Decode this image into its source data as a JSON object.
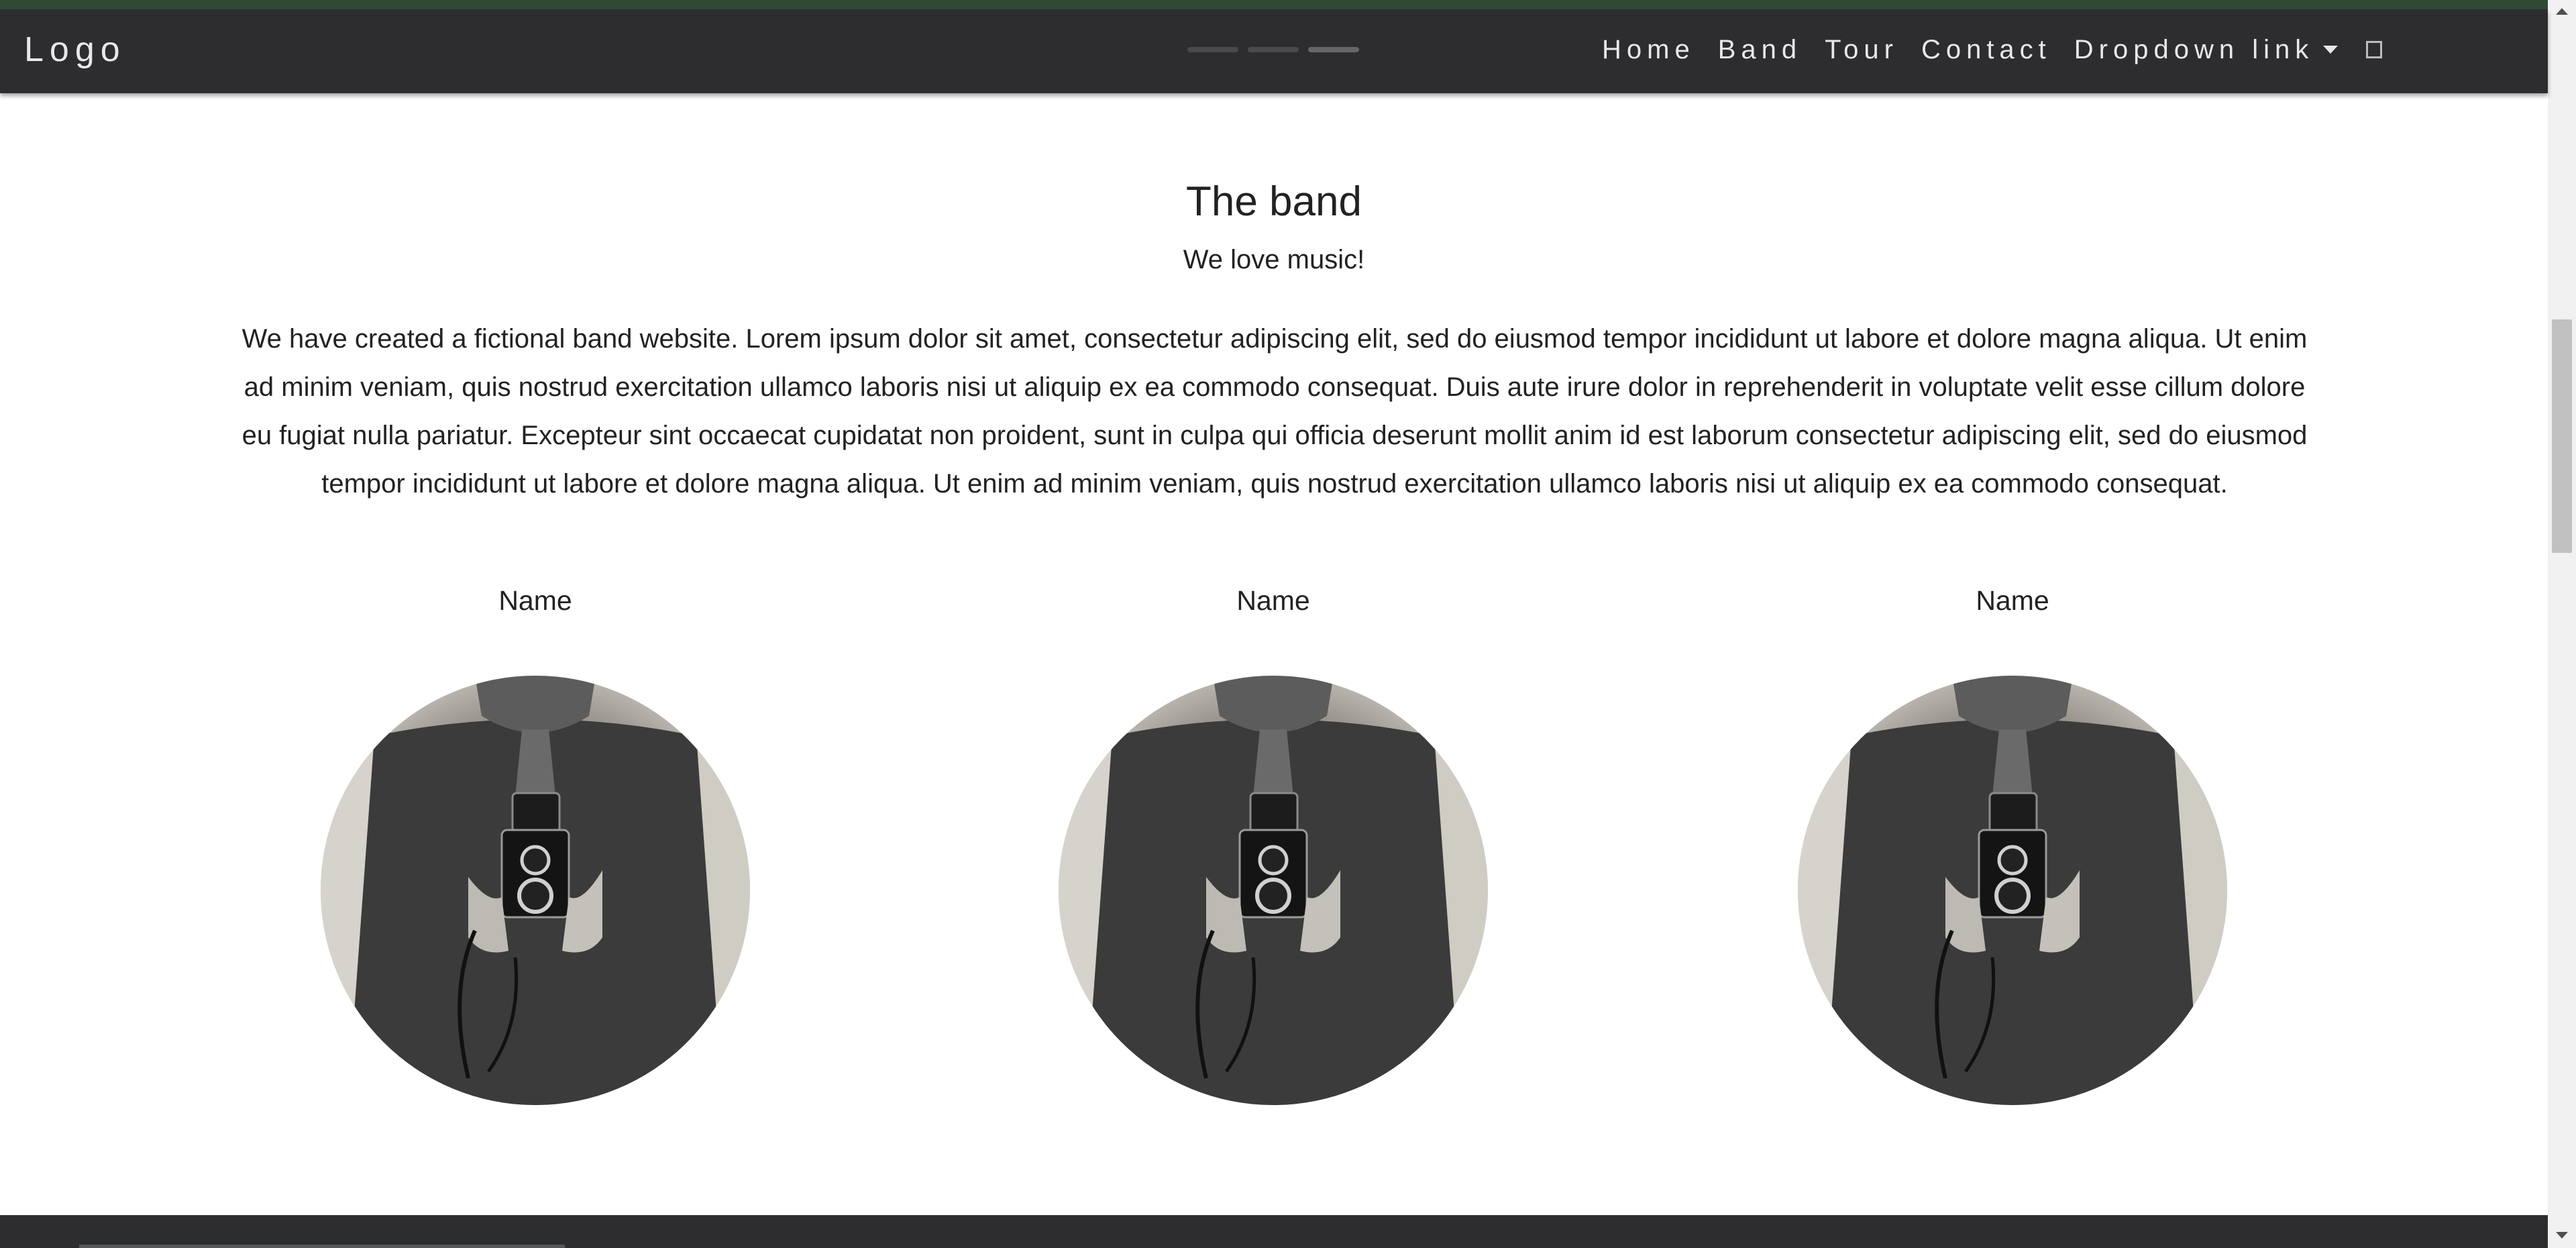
{
  "navbar": {
    "brand": "Logo",
    "items": [
      {
        "label": "Home"
      },
      {
        "label": "Band"
      },
      {
        "label": "Tour"
      },
      {
        "label": "Contact"
      }
    ],
    "dropdown_label": "Dropdown link",
    "search_glyph": "▯"
  },
  "section": {
    "title": "The band",
    "subtitle": "We love music!",
    "body": "We have created a fictional band website. Lorem ipsum dolor sit amet, consectetur adipiscing elit, sed do eiusmod tempor incididunt ut labore et dolore magna aliqua. Ut enim ad minim veniam, quis nostrud exercitation ullamco laboris nisi ut aliquip ex ea commodo consequat. Duis aute irure dolor in reprehenderit in voluptate velit esse cillum dolore eu fugiat nulla pariatur. Excepteur sint occaecat cupidatat non proident, sunt in culpa qui officia deserunt mollit anim id est laborum consectetur adipiscing elit, sed do eiusmod tempor incididunt ut labore et dolore magna aliqua. Ut enim ad minim veniam, quis nostrud exercitation ullamco laboris nisi ut aliquip ex ea commodo consequat."
  },
  "members": [
    {
      "name": "Name"
    },
    {
      "name": "Name"
    },
    {
      "name": "Name"
    }
  ],
  "colors": {
    "navbar_bg": "#2d2d30",
    "nav_text": "#e8e8e8",
    "top_strip": "#2e4a33"
  },
  "icons": {
    "caret": "caret-down-icon",
    "search": "search-placeholder-icon",
    "avatar": "camera-photo-icon"
  }
}
